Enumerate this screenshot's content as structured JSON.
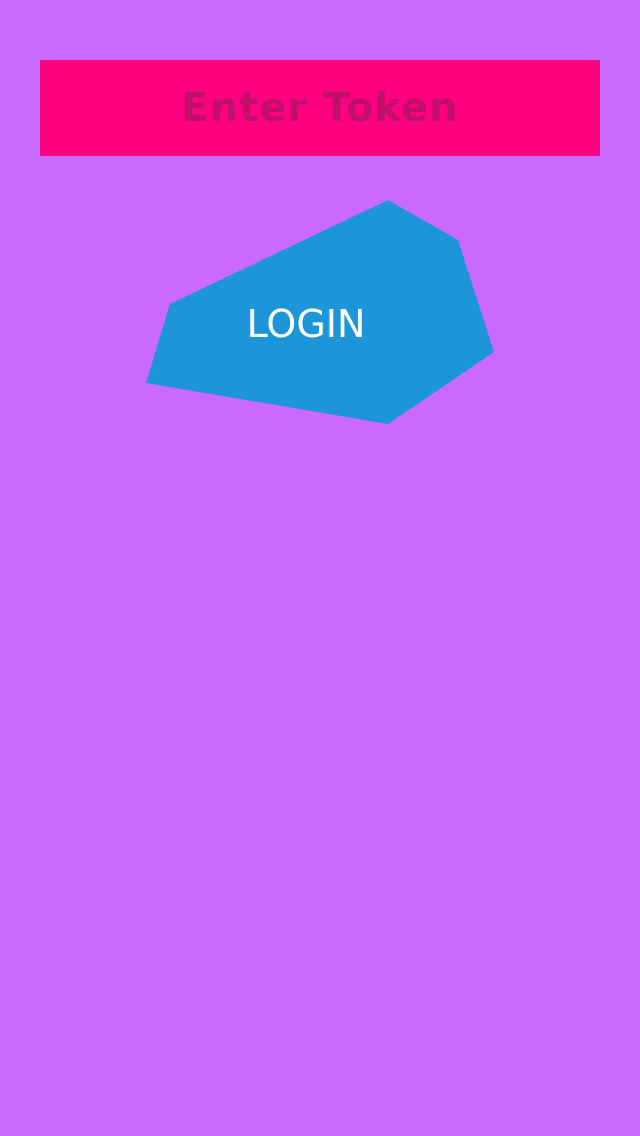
{
  "token_field": {
    "placeholder": "Enter Token",
    "value": ""
  },
  "login_button": {
    "label": "LOGIN"
  },
  "colors": {
    "background": "#C969FF",
    "token_field_bg": "#FF0080",
    "token_placeholder": "#C0106A",
    "login_button_bg": "#1C95D9",
    "login_text": "#FFFFFF"
  }
}
